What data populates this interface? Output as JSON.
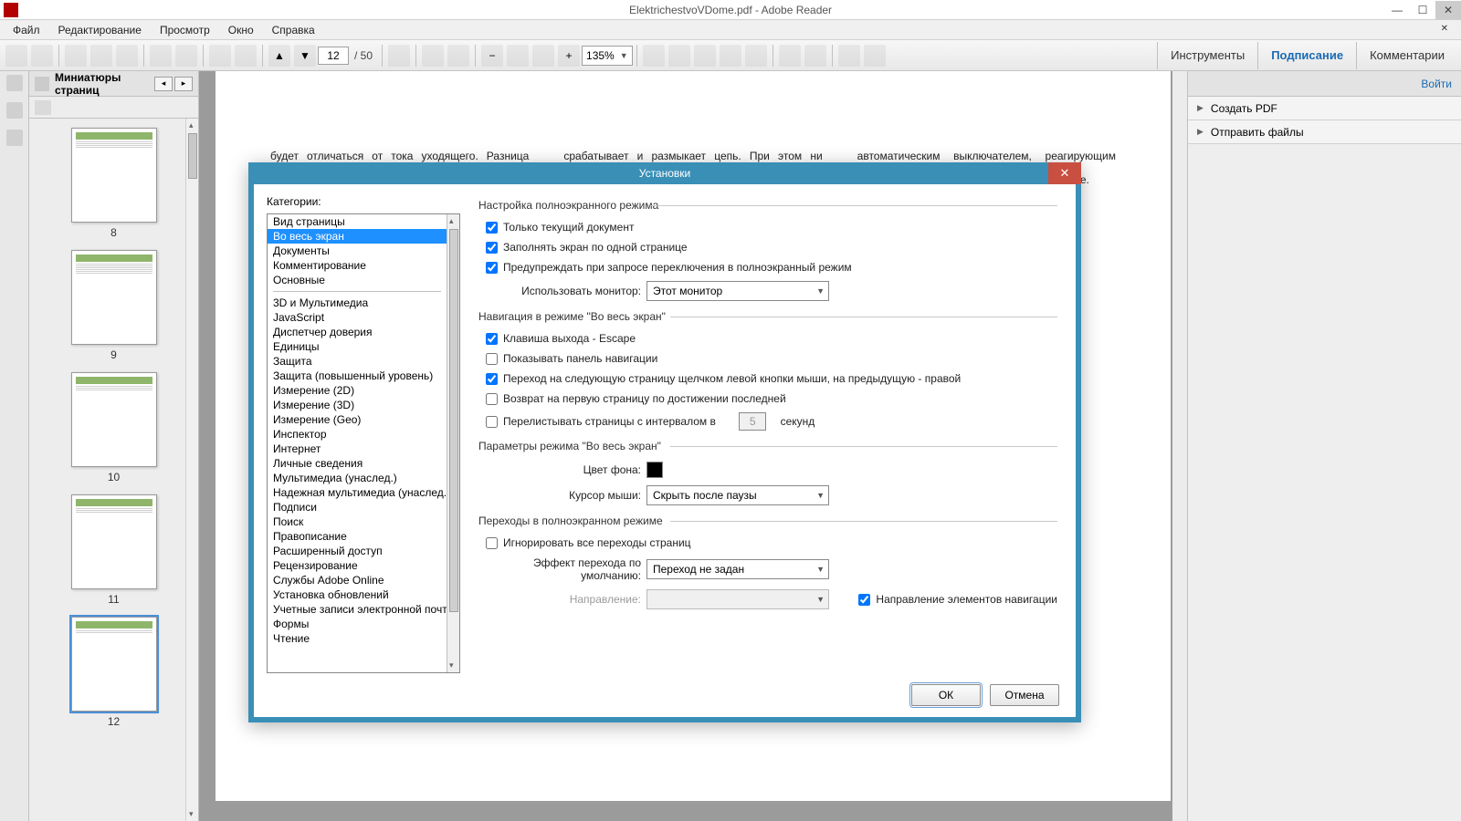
{
  "title": "ElektrichestvoVDome.pdf - Adobe Reader",
  "menu": [
    "Файл",
    "Редактирование",
    "Просмотр",
    "Окно",
    "Справка"
  ],
  "page_current": "12",
  "page_total": "/ 50",
  "zoom": "135%",
  "right_tabs": {
    "tools": "Инструменты",
    "sign": "Подписание",
    "comments": "Комментарии"
  },
  "thumbs_title": "Миниатюры страниц",
  "thumbs": [
    "8",
    "9",
    "10",
    "11",
    "12"
  ],
  "login": "Войти",
  "rp": [
    "Создать PDF",
    "Отправить файлы"
  ],
  "doc_col1": "будет отличаться от тока уходящего. Разница между этими значениями и будет являться величиной тока утечки, или",
  "doc_col2": "срабатывает и размыкает цепь. При этом ни тепловой, ни электромагнитный расцепители автоматического выключа-",
  "doc_col3": "автоматическим выключателем, реагирующим лишь на перегрузку или короткое замыкание.",
  "dlg": {
    "title": "Установки",
    "cat_label": "Категории:",
    "cats": [
      "Вид страницы",
      "Во весь экран",
      "Документы",
      "Комментирование",
      "Основные",
      "—",
      "3D и Мультимедиа",
      "JavaScript",
      "Диспетчер доверия",
      "Единицы",
      "Защита",
      "Защита (повышенный уровень)",
      "Измерение (2D)",
      "Измерение (3D)",
      "Измерение (Geo)",
      "Инспектор",
      "Интернет",
      "Личные сведения",
      "Мультимедиа (унаслед.)",
      "Надежная мультимедиа (унаслед.)",
      "Подписи",
      "Поиск",
      "Правописание",
      "Расширенный доступ",
      "Рецензирование",
      "Службы Adobe Online",
      "Установка обновлений",
      "Учетные записи электронной почты",
      "Формы",
      "Чтение"
    ],
    "sel_cat": "Во весь экран",
    "g1": "Настройка полноэкранного режима",
    "c1": "Только текущий документ",
    "c2": "Заполнять экран по одной странице",
    "c3": "Предупреждать при запросе переключения в полноэкранный режим",
    "mon_lbl": "Использовать монитор:",
    "mon_val": "Этот монитор",
    "g2": "Навигация в режиме \"Во весь экран\"",
    "c4": "Клавиша выхода - Escape",
    "c5": "Показывать панель навигации",
    "c6": "Переход на следующую страницу щелчком левой кнопки мыши, на предыдущую - правой",
    "c7": "Возврат на первую страницу по достижении последней",
    "c8": "Перелистывать страницы с интервалом в",
    "c8v": "5",
    "c8u": "секунд",
    "g3": "Параметры режима \"Во весь экран\"",
    "bg_lbl": "Цвет фона:",
    "cur_lbl": "Курсор мыши:",
    "cur_val": "Скрыть после паузы",
    "g4": "Переходы в полноэкранном режиме",
    "c9": "Игнорировать все переходы страниц",
    "eff_lbl": "Эффект перехода по умолчанию:",
    "eff_val": "Переход не задан",
    "dir_lbl": "Направление:",
    "cnav": "Направление элементов навигации",
    "ok": "ОК",
    "cancel": "Отмена"
  }
}
